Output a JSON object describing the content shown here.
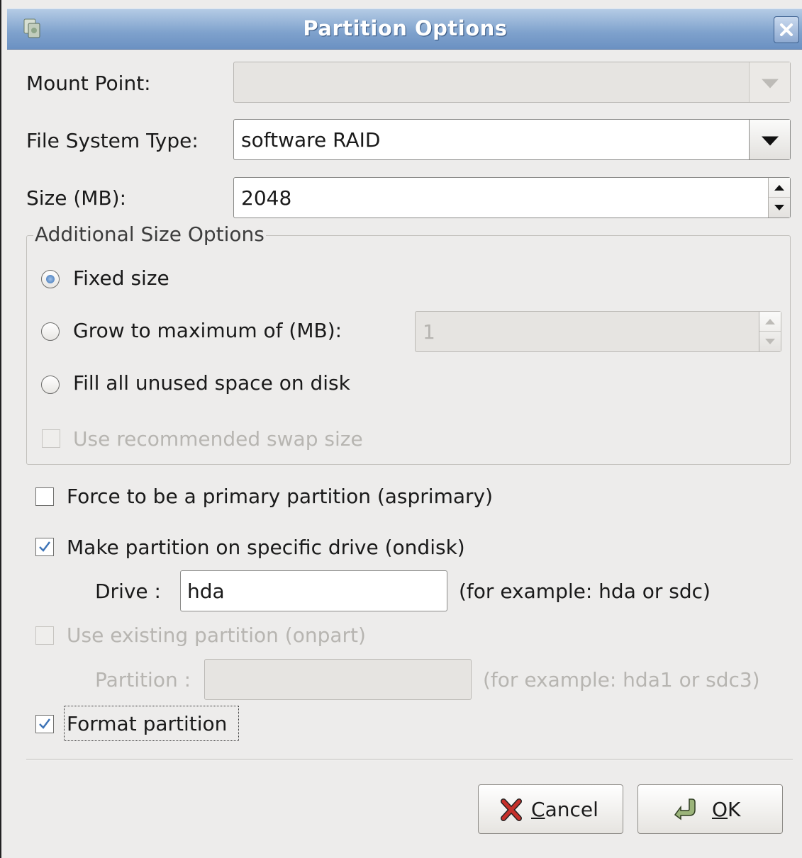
{
  "window": {
    "title": "Partition Options"
  },
  "mount_point": {
    "label": "Mount Point:",
    "value": ""
  },
  "fs_type": {
    "label": "File System Type:",
    "value": "software RAID"
  },
  "size": {
    "label": "Size (MB):",
    "value": "2048"
  },
  "size_options": {
    "title": "Additional Size Options",
    "fixed": "Fixed size",
    "grow": "Grow to maximum of (MB):",
    "grow_value": "1",
    "fill": "Fill all unused space on disk",
    "swap": "Use recommended swap size",
    "selected": "fixed"
  },
  "asprimary": {
    "label": "Force to be a primary partition (asprimary)",
    "checked": false
  },
  "ondisk": {
    "label": "Make partition on specific drive (ondisk)",
    "checked": true,
    "drive_label": "Drive :",
    "drive_value": "hda",
    "drive_hint": "(for example: hda or sdc)"
  },
  "onpart": {
    "label": "Use existing partition (onpart)",
    "checked": false,
    "partition_label": "Partition :",
    "partition_value": "",
    "partition_hint": "(for example: hda1 or sdc3)"
  },
  "format": {
    "label": "Format partition",
    "checked": true
  },
  "buttons": {
    "cancel_mnemonic": "C",
    "cancel_rest": "ancel",
    "ok_mnemonic": "O",
    "ok_rest": "K"
  },
  "colors": {
    "titlebar": "#7ea1cc",
    "dialog_bg": "#edeceb",
    "check_accent": "#3e74b7"
  }
}
